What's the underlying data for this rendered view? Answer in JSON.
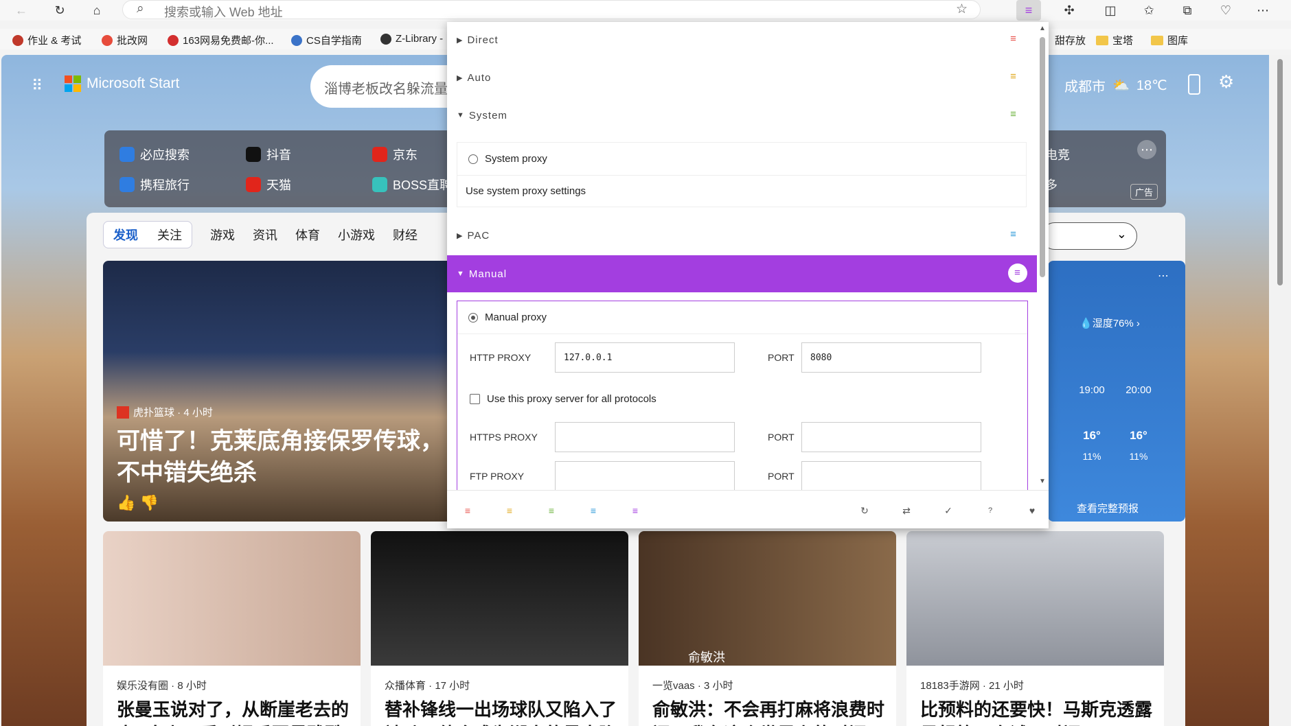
{
  "browser": {
    "address_placeholder": "搜索或输入 Web 地址",
    "bookmarks": [
      {
        "label": "作业 & 考试",
        "color": "#c0392b"
      },
      {
        "label": "批改网",
        "color": "#e74c3c"
      },
      {
        "label": "163网易免费邮-你...",
        "color": "#d32f2f"
      },
      {
        "label": "CS自学指南",
        "color": "#3b73c8"
      },
      {
        "label": "Z-Library -",
        "color": "#333333"
      }
    ],
    "right_bookmarks": [
      {
        "label": "甜存放"
      },
      {
        "label": "宝塔"
      },
      {
        "label": "图库"
      }
    ]
  },
  "page": {
    "brand": "Microsoft Start",
    "search_text": "淄博老板改名躲流量",
    "city": "成都市",
    "temp": "18℃",
    "quick_links": [
      {
        "label": "必应搜索",
        "color": "#2f7de1"
      },
      {
        "label": "抖音",
        "color": "#111111"
      },
      {
        "label": "京东",
        "color": "#e1251b"
      },
      {
        "label": "携程旅行",
        "color": "#2f7de1"
      },
      {
        "label": "天猫",
        "color": "#e1251b"
      },
      {
        "label": "BOSS直聘",
        "color": "#37c2bc"
      }
    ],
    "quick_right": [
      "电竞",
      "多"
    ],
    "ad_label": "广告",
    "tabs": {
      "active": "发现",
      "follow": "关注",
      "items": [
        "游戏",
        "资讯",
        "体育",
        "小游戏",
        "财经"
      ]
    },
    "hero": {
      "source": "虎扑篮球 · 4 小时",
      "title": "可惜了！克莱底角接保罗传球，不中错失绝杀"
    },
    "weather": {
      "humidity": "湿度76%",
      "hours": [
        {
          "time": "19:00",
          "temp": "16°",
          "precip": "11%"
        },
        {
          "time": "20:00",
          "temp": "16°",
          "precip": "11%"
        }
      ],
      "more": "查看完整预报"
    },
    "cards": [
      {
        "source": "娱乐没有圈 · 8 小时",
        "title": "张曼玉说对了，从断崖老去的大S身上，看到娱乐圈最残酷",
        "caption": ""
      },
      {
        "source": "众播体育 · 17 小时",
        "title": "替补锋线一出场球队又陷入了被动，他会成为湖人的最大隐",
        "caption": ""
      },
      {
        "source": "一览vaas · 3 小时",
        "title": "俞敏洪：不会再打麻将浪费时间，我在这个世界上的时间已",
        "caption": "俞敏洪"
      },
      {
        "source": "18183手游网 · 21 小时",
        "title": "比预料的还要快！马斯克透露星舰第四次试飞时间",
        "caption": ""
      }
    ]
  },
  "popup": {
    "sections": [
      {
        "label": "Direct",
        "icon_color": "#e8554e",
        "caret": "▶"
      },
      {
        "label": "Auto",
        "icon_color": "#e0a91e",
        "caret": "▶"
      },
      {
        "label": "System",
        "icon_color": "#6cb33e",
        "caret": "▼"
      },
      {
        "label": "PAC",
        "icon_color": "#2f9ad8",
        "caret": "▶"
      },
      {
        "label": "Manual",
        "icon_color": "#a33ee0",
        "caret": "▼"
      }
    ],
    "system": {
      "radio_label": "System proxy",
      "settings_label": "Use system proxy settings"
    },
    "manual": {
      "radio_label": "Manual proxy",
      "http_label": "HTTP PROXY",
      "http_value": "127.0.0.1",
      "port_label": "PORT",
      "http_port": "8080",
      "all_protocols_label": "Use this proxy server for all protocols",
      "https_label": "HTTPS PROXY",
      "https_value": "",
      "https_port": "",
      "ftp_label": "FTP PROXY",
      "ftp_value": "",
      "ftp_port": ""
    },
    "footer_icons": [
      "direct-icon",
      "auto-icon",
      "system-icon",
      "pac-icon",
      "manual-icon"
    ],
    "footer_actions": [
      "refresh-icon",
      "swap-icon",
      "check-icon",
      "help-icon",
      "heart-icon"
    ]
  }
}
